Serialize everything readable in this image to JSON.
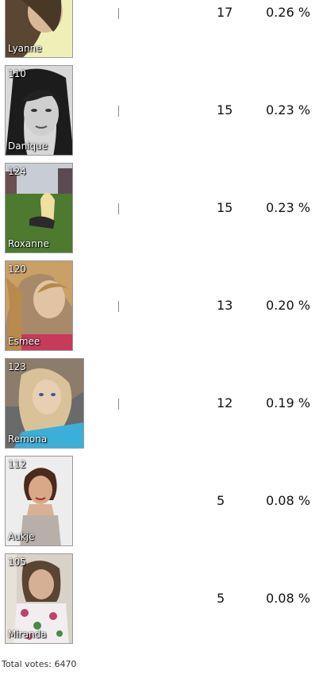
{
  "entries": [
    {
      "number": "",
      "name": "Lyanne",
      "votes": "17",
      "percent": "0.26 %",
      "vote_fraction": 0.0026
    },
    {
      "number": "110",
      "name": "Danique",
      "votes": "15",
      "percent": "0.23 %",
      "vote_fraction": 0.0023
    },
    {
      "number": "124",
      "name": "Roxanne",
      "votes": "15",
      "percent": "0.23 %",
      "vote_fraction": 0.0023
    },
    {
      "number": "120",
      "name": "Esmee",
      "votes": "13",
      "percent": "0.20 %",
      "vote_fraction": 0.002
    },
    {
      "number": "123",
      "name": "Remona",
      "votes": "12",
      "percent": "0.19 %",
      "vote_fraction": 0.0019
    },
    {
      "number": "112",
      "name": "Aukje",
      "votes": "5",
      "percent": "0.08 %",
      "vote_fraction": 0.0008
    },
    {
      "number": "105",
      "name": "Miranda",
      "votes": "5",
      "percent": "0.08 %",
      "vote_fraction": 0.0008
    }
  ],
  "footer": {
    "total_votes": "Total votes: 6470"
  }
}
